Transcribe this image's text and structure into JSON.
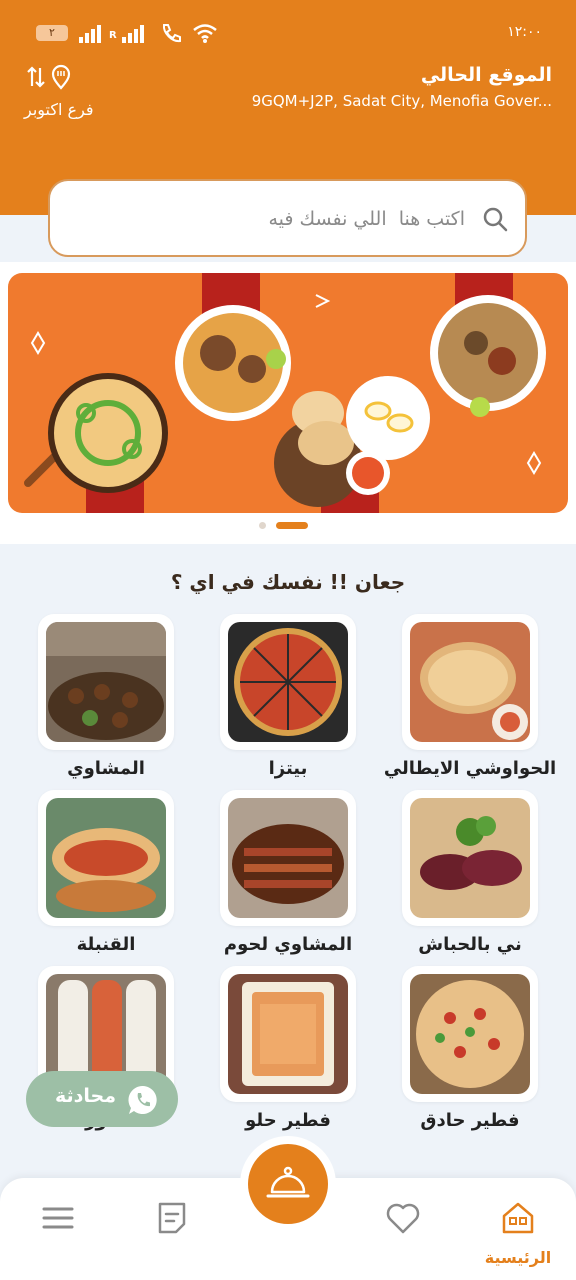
{
  "status_bar": {
    "time": "١٢:٠٠",
    "battery": "٢",
    "network_label": "R"
  },
  "location": {
    "title": "الموقع الحالي",
    "address": "9GQM+J2P, Sadat City, Menofia Gover...",
    "branch": "فرع اكتوبر"
  },
  "search": {
    "placeholder": "اكتب هنا  اللي نفسك فيه"
  },
  "banner": {
    "slide_count": 2,
    "active_slide": 2
  },
  "section": {
    "title": "جعان !! نفسك في اي ؟"
  },
  "categories": [
    {
      "label": "الحواوشي الايطالي",
      "icon": "hawawshi-photo"
    },
    {
      "label": "بيتزا",
      "icon": "pizza-photo"
    },
    {
      "label": "المشاوي",
      "icon": "grill-photo"
    },
    {
      "label": "ني بالحباش",
      "icon": "raw-liver-photo"
    },
    {
      "label": "المشاوي لحوم",
      "icon": "grilled-meat-photo"
    },
    {
      "label": "القنبلة",
      "icon": "bomb-sandwich-photo"
    },
    {
      "label": "فطير حادق",
      "icon": "savory-pie-photo"
    },
    {
      "label": "فطير حلو",
      "icon": "sweet-pie-photo"
    },
    {
      "label": "الشاورما",
      "icon": "shawarma-photo"
    }
  ],
  "chat": {
    "label": "محادثة"
  },
  "nav": {
    "home_label": "الرئيسية"
  },
  "colors": {
    "brand": "#e4801c",
    "background": "#eef3f9",
    "chat": "#9dbfa6",
    "nav_icon": "#8a8a8a"
  }
}
